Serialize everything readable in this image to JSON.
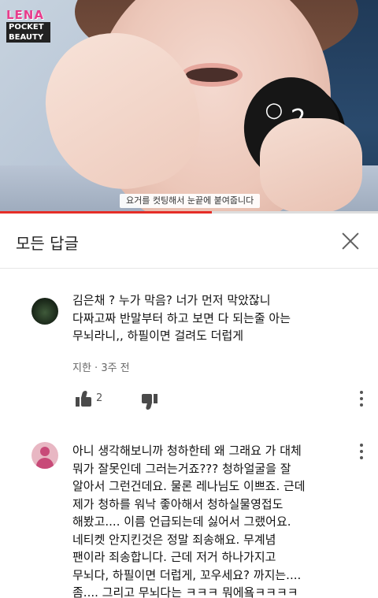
{
  "video": {
    "logo_line1": "LENA",
    "logo_line2": "POCKET",
    "logo_line3": "BEAUTY",
    "caption": "요거를 컷팅해서 눈끝에 붙여줍니다",
    "progress_fraction": 0.56,
    "accent_color": "#e52d27"
  },
  "header": {
    "title": "모든 답글",
    "close_icon": "close-icon"
  },
  "comments": [
    {
      "avatar": "dark-photo-avatar",
      "text": "김은채 ? 누가 막음? 너가 먼저 막았잖니\n다짜고짜 반말부터 하고 보면 다 되는줄 아는\n무뇌라니,, 하필이면 걸려도 더럽게",
      "meta": "지한 · 3주 전",
      "like_count": "2"
    },
    {
      "avatar": "default-avatar",
      "text": "아니 생각해보니까 청하한테 왜 그래요 가 대체\n뭐가 잘못인데 그러는거죠??? 청하얼굴을 잘\n알아서 그런건데요. 물론 레나님도 이쁘죠. 근데\n제가 청하를 워낙 좋아해서 청하실물영접도\n해봤고.... 이름 언급되는데 싫어서 그랬어요.\n네티켓 안지킨것은 정말 죄송해요. 무계념\n팬이라 죄송합니다.  근데 저거 하나가지고\n무뇌다, 하필이면 더럽게, 꼬우세요? 까지는....\n좀.... 그리고 무뇌다는 ㅋㅋㅋ 뭐에욬ㅋㅋㅋㅋ"
    }
  ]
}
